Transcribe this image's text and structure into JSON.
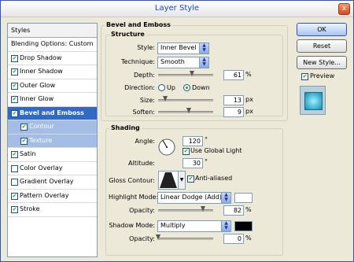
{
  "window": {
    "title": "Layer Style",
    "close_glyph": "x"
  },
  "styles_panel": {
    "header": "Styles",
    "items": [
      {
        "label": "Blending Options: Custom",
        "checked": null
      },
      {
        "label": "Drop Shadow",
        "checked": true
      },
      {
        "label": "Inner Shadow",
        "checked": true
      },
      {
        "label": "Outer Glow",
        "checked": true
      },
      {
        "label": "Inner Glow",
        "checked": true
      },
      {
        "label": "Bevel and Emboss",
        "checked": true,
        "selected": true
      },
      {
        "label": "Contour",
        "checked": true,
        "sub": true
      },
      {
        "label": "Texture",
        "checked": true,
        "sub": true
      },
      {
        "label": "Satin",
        "checked": true
      },
      {
        "label": "Color Overlay",
        "checked": false
      },
      {
        "label": "Gradient Overlay",
        "checked": false
      },
      {
        "label": "Pattern Overlay",
        "checked": true
      },
      {
        "label": "Stroke",
        "checked": true
      }
    ]
  },
  "bevel": {
    "section_title": "Bevel and Emboss",
    "structure_title": "Structure",
    "style_label": "Style:",
    "style_value": "Inner Bevel",
    "technique_label": "Technique:",
    "technique_value": "Smooth",
    "depth_label": "Depth:",
    "depth_value": "61",
    "depth_unit": "%",
    "depth_slider": 0.61,
    "direction_label": "Direction:",
    "direction_up": "Up",
    "direction_down": "Down",
    "direction_selected": "Down",
    "size_label": "Size:",
    "size_value": "13",
    "size_unit": "px",
    "size_slider": 0.13,
    "soften_label": "Soften:",
    "soften_value": "9",
    "soften_unit": "px",
    "soften_slider": 0.56
  },
  "shading": {
    "title": "Shading",
    "angle_label": "Angle:",
    "angle_value": "120",
    "angle_unit": "°",
    "global_light_label": "Use Global Light",
    "global_light": true,
    "altitude_label": "Altitude:",
    "altitude_value": "30",
    "altitude_unit": "°",
    "gloss_label": "Gloss Contour:",
    "antialiased_label": "Anti-aliased",
    "antialiased": true,
    "highlight_label": "Highlight Mode:",
    "highlight_value": "Linear Dodge (Add)",
    "highlight_color": "#ffffff",
    "highlight_opacity_label": "Opacity:",
    "highlight_opacity_value": "82",
    "highlight_opacity_unit": "%",
    "highlight_opacity_slider": 0.82,
    "shadow_label": "Shadow Mode:",
    "shadow_value": "Multiply",
    "shadow_color": "#000000",
    "shadow_opacity_label": "Opacity:",
    "shadow_opacity_value": "0",
    "shadow_opacity_unit": "%",
    "shadow_opacity_slider": 0.0
  },
  "buttons": {
    "ok": "OK",
    "reset": "Reset",
    "new_style": "New Style...",
    "preview_label": "Preview",
    "preview_checked": true
  }
}
